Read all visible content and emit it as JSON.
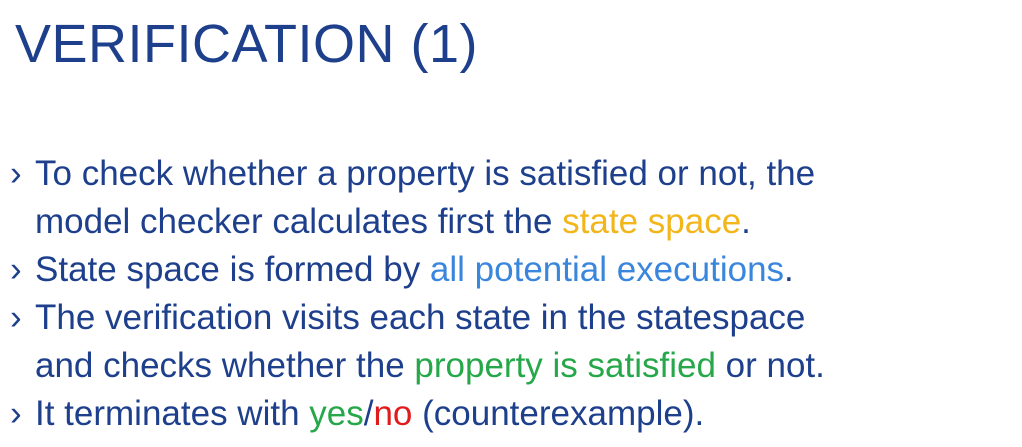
{
  "slide": {
    "title": "VERIFICATION (1)",
    "bullet_marker": "›",
    "bullets": [
      {
        "line1": "To check whether a property is satisfied or not, the",
        "line2_pre": "model checker calculates first the ",
        "highlight": "state space",
        "line2_post": "."
      },
      {
        "pre": "State space is formed by ",
        "highlight": "all potential executions",
        "post": "."
      },
      {
        "line1": "The verification visits each state in the statespace",
        "line2_pre": "and checks whether the ",
        "highlight": "property is satisfied",
        "line2_post": " or not."
      },
      {
        "pre": "It terminates with ",
        "yes": "yes",
        "slash": "/",
        "no": "no",
        "post": " (counterexample)."
      }
    ]
  },
  "colors": {
    "text": "#1d3f8c",
    "state_space": "#f2b61b",
    "executions": "#3b86dd",
    "satisfied": "#26a84a",
    "yes": "#26a84a",
    "no": "#e01b1b"
  }
}
